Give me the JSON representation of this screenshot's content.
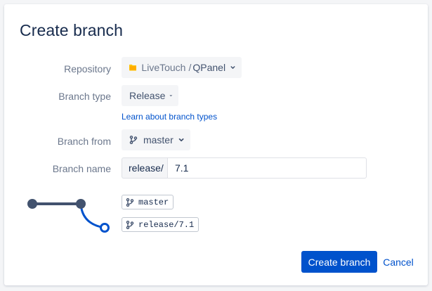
{
  "dialog": {
    "title": "Create branch"
  },
  "form": {
    "repository": {
      "label": "Repository",
      "project": "LiveTouch",
      "separator": "/",
      "repo": "QPanel",
      "icon": "folder-icon"
    },
    "branch_type": {
      "label": "Branch type",
      "value": "Release",
      "help_link": "Learn about branch types"
    },
    "branch_from": {
      "label": "Branch from",
      "value": "master",
      "icon": "branch-icon"
    },
    "branch_name": {
      "label": "Branch name",
      "prefix": "release/",
      "value": "7.1"
    }
  },
  "preview": {
    "source_branch": "master",
    "new_branch": "release/7.1"
  },
  "actions": {
    "create_label": "Create branch",
    "cancel_label": "Cancel"
  },
  "colors": {
    "primary": "#0052cc",
    "graph_line": "#42526e",
    "new_branch_line": "#0052cc",
    "folder": "#ffc400"
  }
}
